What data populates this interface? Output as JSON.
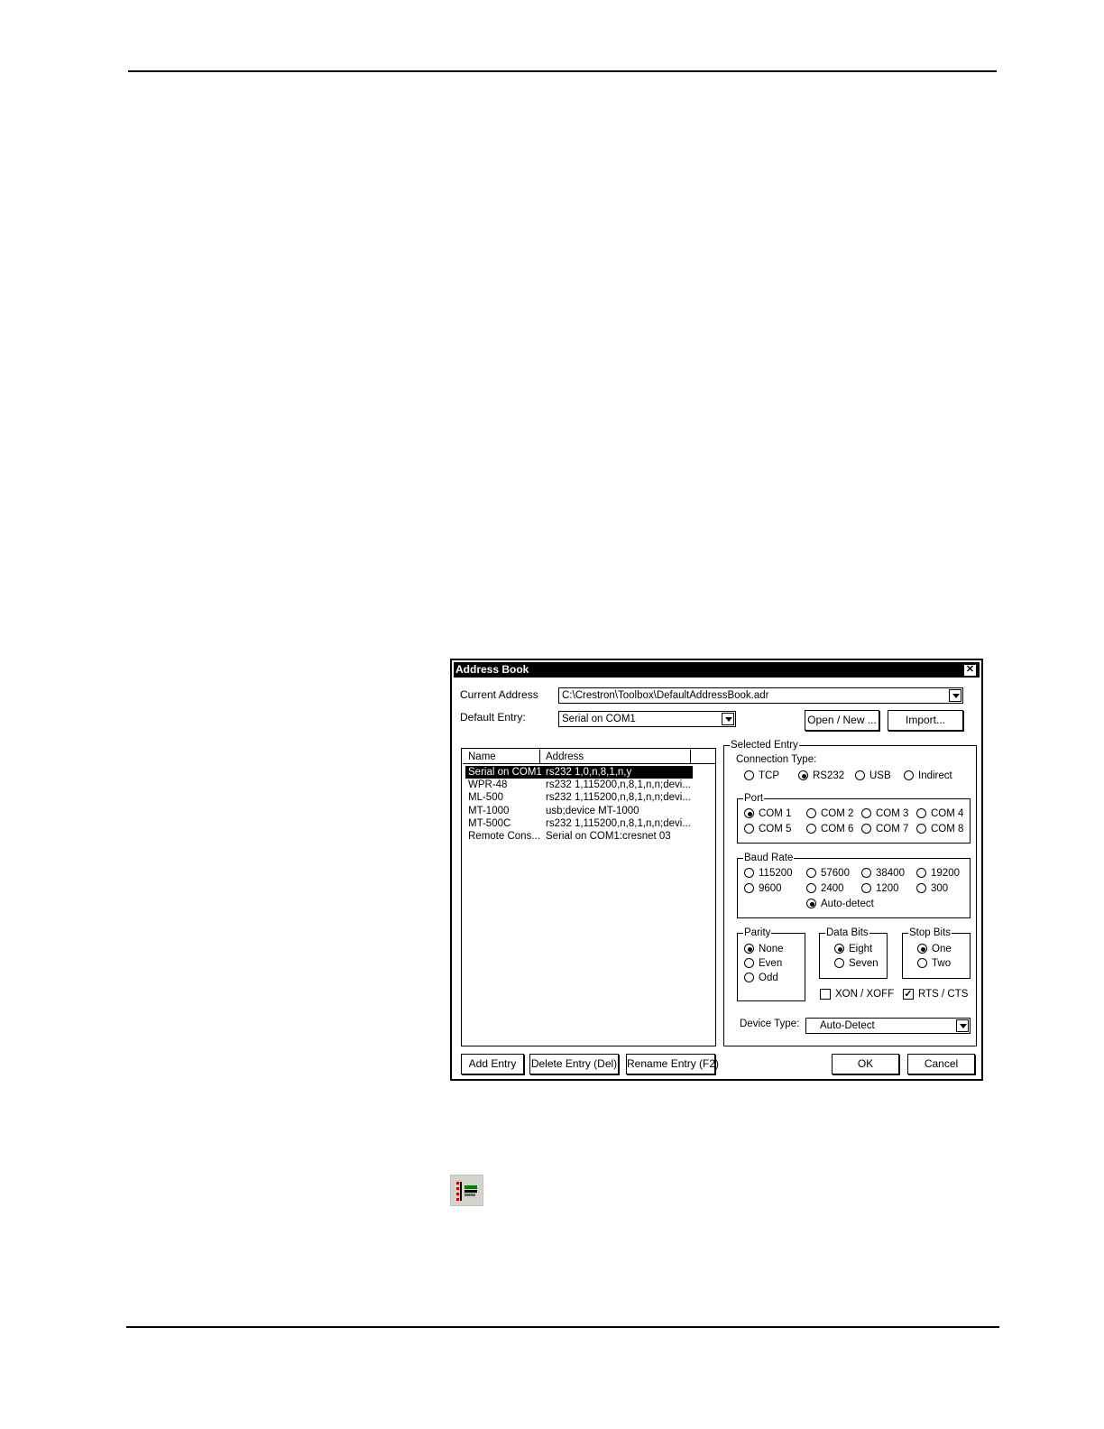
{
  "dialog": {
    "title": "Address Book",
    "current_address_label": "Current Address",
    "current_address_value": "C:\\Crestron\\Toolbox\\DefaultAddressBook.adr",
    "default_entry_label": "Default Entry:",
    "default_entry_value": "Serial on COM1",
    "open_new_label": "Open / New ...",
    "import_label": "Import..."
  },
  "list": {
    "columns": [
      "Name",
      "Address"
    ],
    "rows": [
      {
        "name": "Serial on COM1",
        "address": "rs232 1,0,n,8,1,n,y",
        "selected": true
      },
      {
        "name": "WPR-48",
        "address": "rs232 1,115200,n,8,1,n,n;devi..."
      },
      {
        "name": "ML-500",
        "address": "rs232 1,115200,n,8,1,n,n;devi..."
      },
      {
        "name": "MT-1000",
        "address": "usb;device MT-1000"
      },
      {
        "name": "MT-500C",
        "address": "rs232 1,115200,n,8,1,n,n;devi..."
      },
      {
        "name": "Remote Cons...",
        "address": "Serial on COM1:cresnet 03"
      }
    ]
  },
  "selected_entry": {
    "title": "Selected Entry",
    "connection_type_label": "Connection Type:",
    "connection_types": [
      "TCP",
      "RS232",
      "USB",
      "Indirect"
    ],
    "connection_selected": "RS232",
    "port_title": "Port",
    "ports": [
      "COM 1",
      "COM 2",
      "COM 3",
      "COM 4",
      "COM 5",
      "COM 6",
      "COM 7",
      "COM 8"
    ],
    "port_selected": "COM 1",
    "baud_title": "Baud Rate",
    "bauds": [
      "115200",
      "57600",
      "38400",
      "19200",
      "9600",
      "2400",
      "1200",
      "300",
      "Auto-detect"
    ],
    "baud_selected": "Auto-detect",
    "parity_title": "Parity",
    "parity": [
      "None",
      "Even",
      "Odd"
    ],
    "parity_selected": "None",
    "data_bits_title": "Data Bits",
    "data_bits": [
      "Eight",
      "Seven"
    ],
    "data_bits_selected": "Eight",
    "stop_bits_title": "Stop Bits",
    "stop_bits": [
      "One",
      "Two"
    ],
    "stop_bits_selected": "One",
    "xon_xoff_label": "XON / XOFF",
    "xon_xoff_checked": false,
    "rts_cts_label": "RTS / CTS",
    "rts_cts_checked": true,
    "device_type_label": "Device Type:",
    "device_type_value": "Auto-Detect"
  },
  "buttons": {
    "add_entry": "Add Entry",
    "delete_entry": "Delete Entry (Del)",
    "rename_entry": "Rename Entry (F2)",
    "ok": "OK",
    "cancel": "Cancel"
  },
  "close_glyph": "✕",
  "check_glyph": "✓",
  "toolbar_icon": "address-book-icon"
}
